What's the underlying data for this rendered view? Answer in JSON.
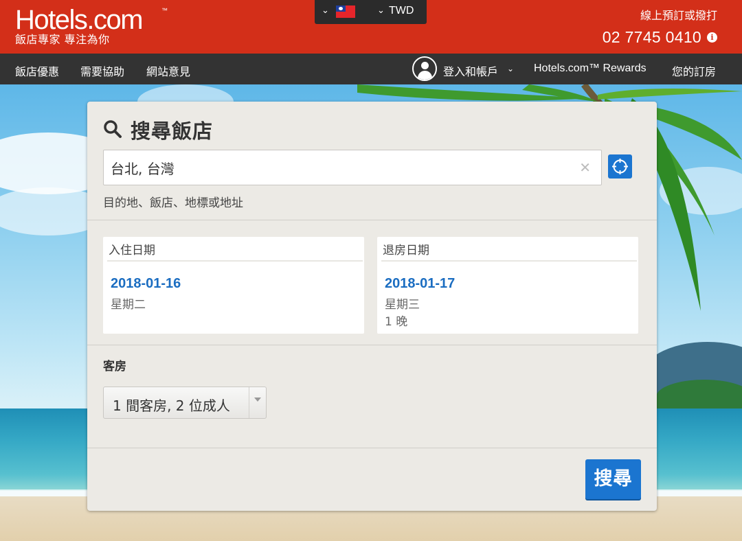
{
  "header": {
    "logo_main": "Hotels.com",
    "logo_tm": "™",
    "logo_tagline": "飯店專家 專注為你",
    "locale": {
      "flag": "taiwan-flag-icon",
      "currency": "TWD"
    },
    "phone_label": "線上預訂或撥打",
    "phone_number": "02 7745 0410"
  },
  "nav": {
    "left_items": [
      "飯店優惠",
      "需要協助",
      "網站意見"
    ],
    "account_label": "登入和帳戶",
    "rewards_label": "Hotels.com™ Rewards",
    "bookings_label": "您的訂房"
  },
  "search": {
    "title": "搜尋飯店",
    "destination_value": "台北, 台灣",
    "destination_hint": "目的地、飯店、地標或地址",
    "checkin": {
      "label": "入住日期",
      "date": "2018-01-16",
      "weekday": "星期二"
    },
    "checkout": {
      "label": "退房日期",
      "date": "2018-01-17",
      "weekday": "星期三",
      "nights": "1 晚"
    },
    "rooms_label": "客房",
    "rooms_value": "1 間客房, 2 位成人",
    "submit_label": "搜尋"
  },
  "colors": {
    "brand_red": "#d32f19",
    "nav_dark": "#333333",
    "accent_blue": "#1b75d0",
    "date_blue": "#1b6dc1",
    "panel_bg": "#eceae5"
  }
}
